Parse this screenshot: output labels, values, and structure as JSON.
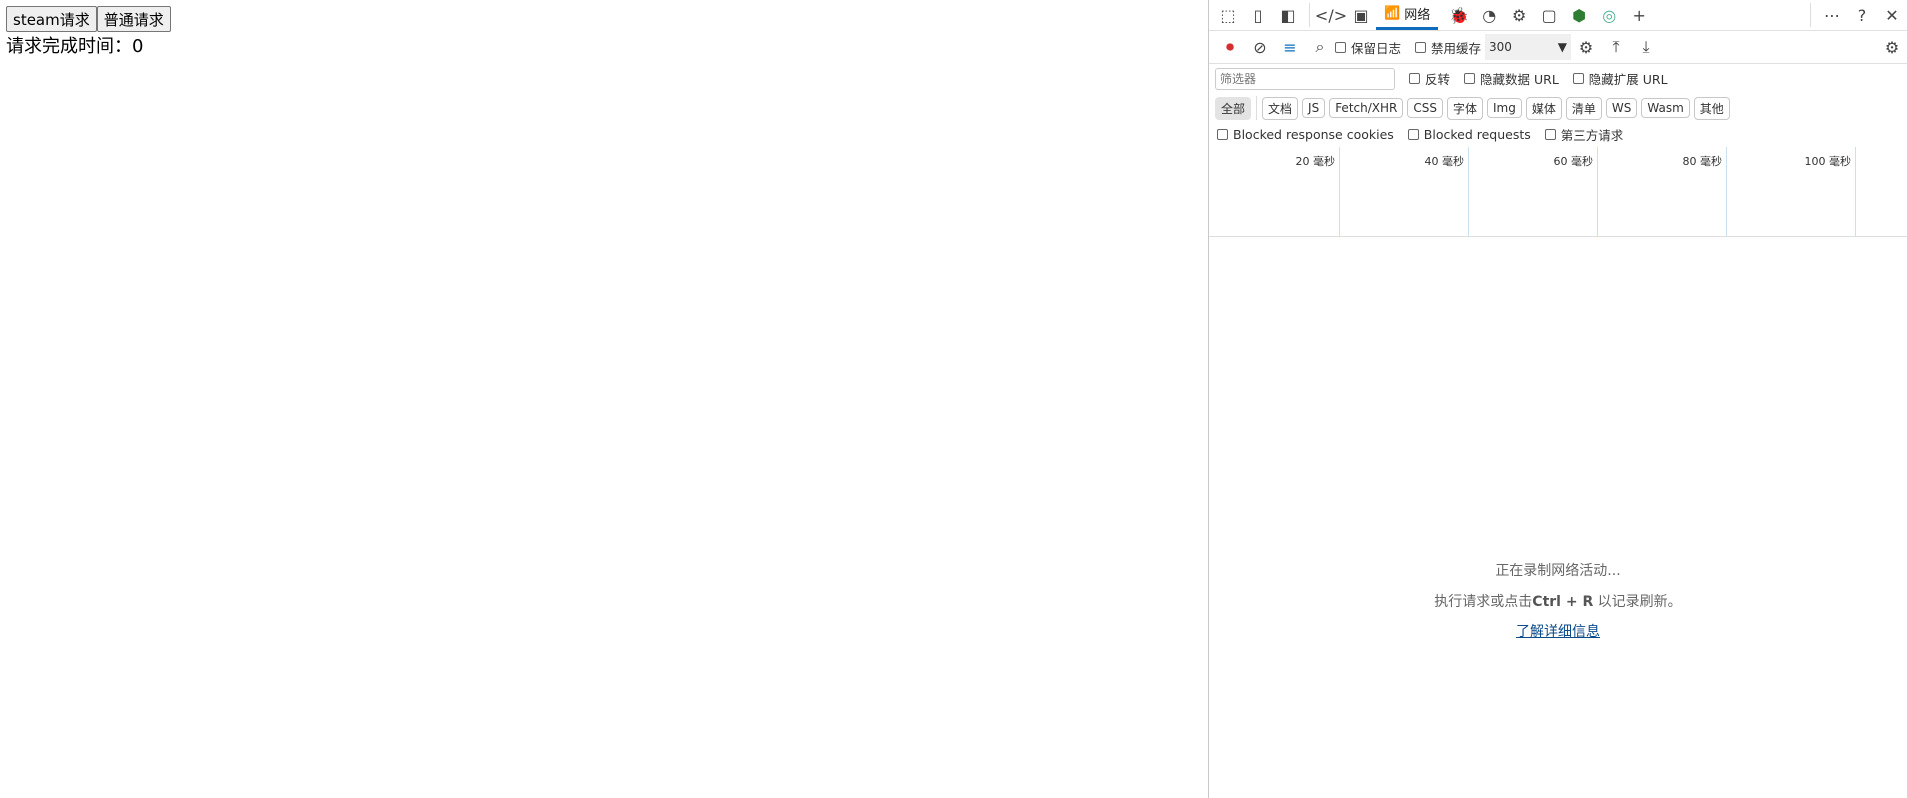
{
  "page": {
    "buttons": [
      "steam请求",
      "普通请求"
    ],
    "result_label": "请求完成时间：",
    "result_value": "0"
  },
  "devtools": {
    "tabs": {
      "network": "网络"
    },
    "toolbar": {
      "preserve_log": "保留日志",
      "disable_cache": "禁用缓存",
      "throttle": "300"
    },
    "filter": {
      "placeholder": "筛选器",
      "invert": "反转",
      "hide_data_url": "隐藏数据 URL",
      "hide_ext_url": "隐藏扩展 URL"
    },
    "types": [
      "全部",
      "文档",
      "JS",
      "Fetch/XHR",
      "CSS",
      "字体",
      "Img",
      "媒体",
      "清单",
      "WS",
      "Wasm",
      "其他"
    ],
    "blocked": [
      "Blocked response cookies",
      "Blocked requests",
      "第三方请求"
    ],
    "timeline": [
      "20 毫秒",
      "40 毫秒",
      "60 毫秒",
      "80 毫秒",
      "100 毫秒"
    ],
    "empty": {
      "line1": "正在录制网络活动...",
      "line2_pre": "执行请求或点击",
      "line2_key": "Ctrl + R",
      "line2_post": " 以记录刷新。",
      "link": "了解详细信息"
    },
    "colors": {
      "accent": "#0f6cbd",
      "record": "#d32f2f"
    }
  }
}
